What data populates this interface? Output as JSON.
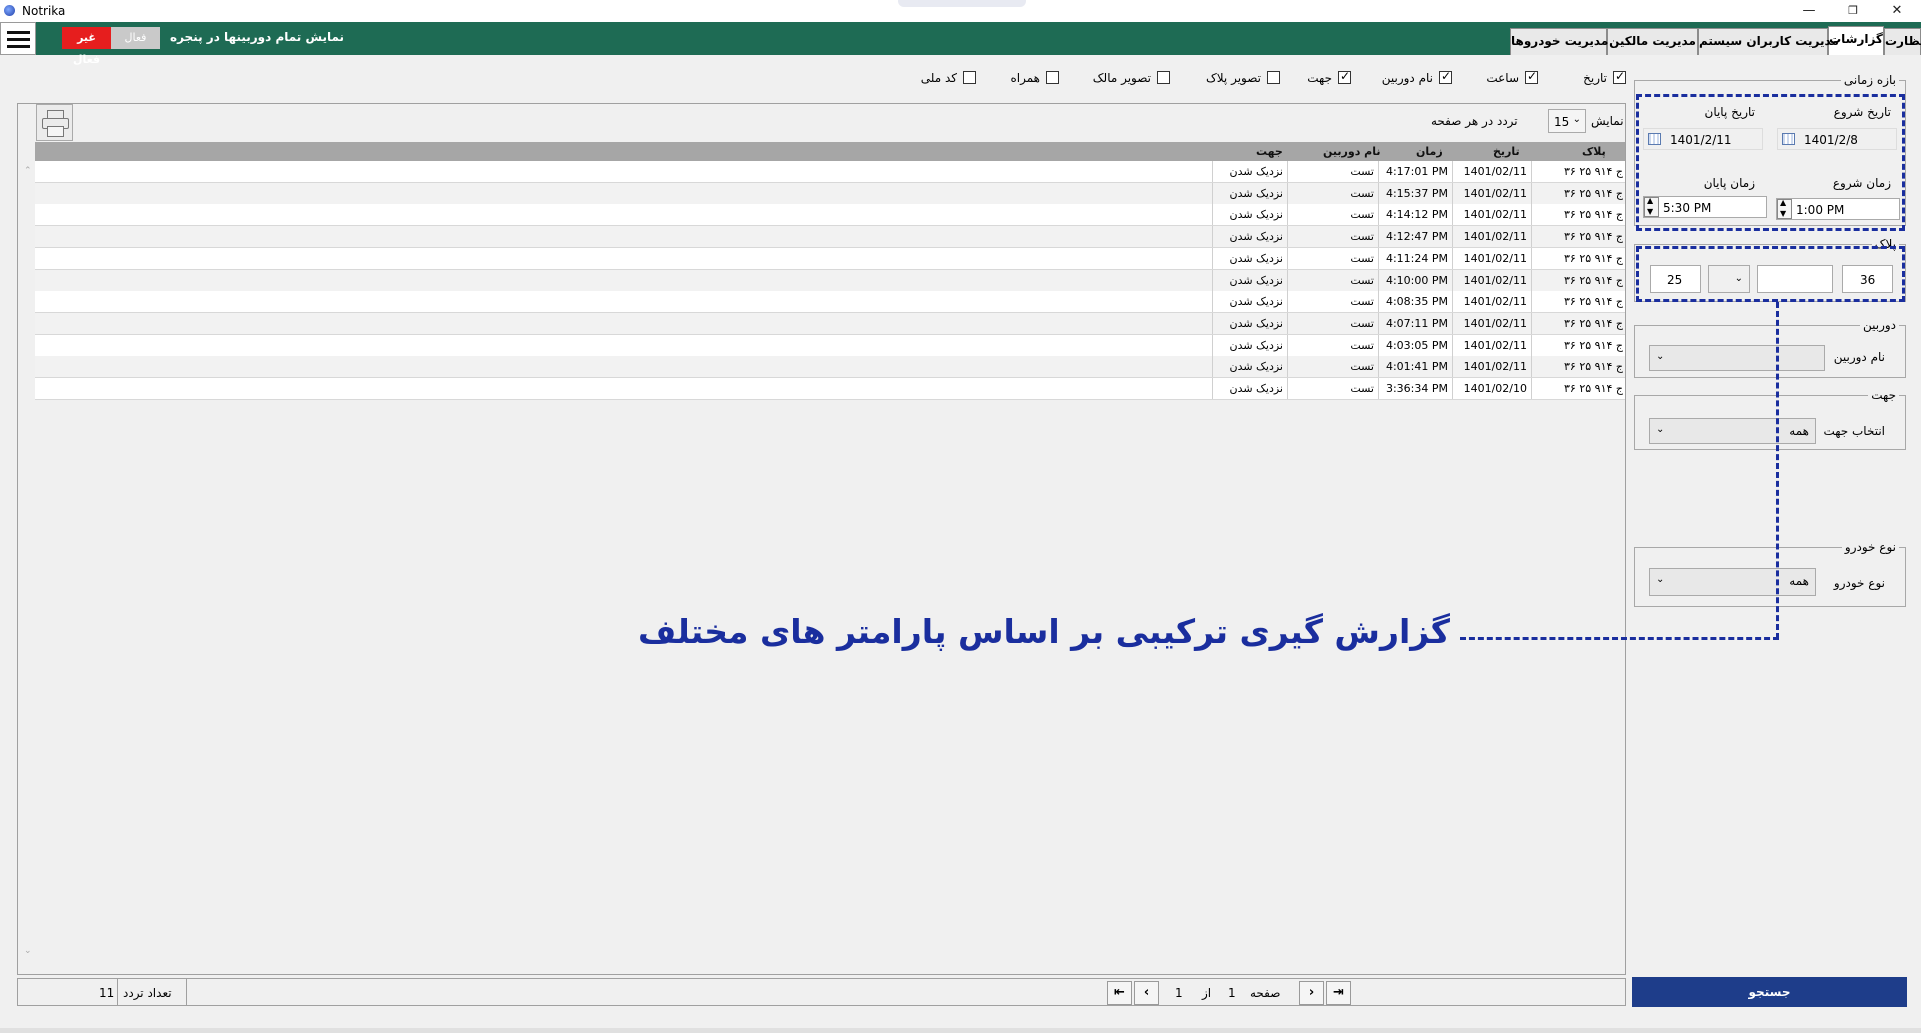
{
  "window": {
    "title": "Notrika",
    "minimize": "—",
    "restore": "❐",
    "close": "✕"
  },
  "header": {
    "status_off": "غیر فعال",
    "status_on": "فعال",
    "label": "نمایش تمام دوربینها در پنجره",
    "tabs": [
      {
        "label": "نظارت"
      },
      {
        "label": "گزارشات"
      },
      {
        "label": "مدیریت کاربران سیستم"
      },
      {
        "label": "مدیریت مالکین"
      },
      {
        "label": "مدیریت خودروها"
      }
    ]
  },
  "column_toggles": [
    {
      "label": "تاریخ",
      "checked": true
    },
    {
      "label": "ساعت",
      "checked": true
    },
    {
      "label": "نام دوربین",
      "checked": true
    },
    {
      "label": "جهت",
      "checked": true
    },
    {
      "label": "تصویر پلاک",
      "checked": false
    },
    {
      "label": "تصویر مالک",
      "checked": false
    },
    {
      "label": "همراه",
      "checked": false
    },
    {
      "label": "کد ملی",
      "checked": false
    }
  ],
  "grid": {
    "show_label": "نمایش",
    "page_size": "15",
    "per_page_label": "تردد در هر صفحه",
    "columns": [
      "پلاک",
      "تاریخ",
      "زمان",
      "نام دوربین",
      "جهت"
    ],
    "rows": [
      [
        "۳۶ ج ۹۱۴ ۲۵",
        "1401/02/11",
        "4:17:01 PM",
        "تست",
        "نزدیک شدن"
      ],
      [
        "۳۶ ج ۹۱۴ ۲۵",
        "1401/02/11",
        "4:15:37 PM",
        "تست",
        "نزدیک شدن"
      ],
      [
        "۳۶ ج ۹۱۴ ۲۵",
        "1401/02/11",
        "4:14:12 PM",
        "تست",
        "نزدیک شدن"
      ],
      [
        "۳۶ ج ۹۱۴ ۲۵",
        "1401/02/11",
        "4:12:47 PM",
        "تست",
        "نزدیک شدن"
      ],
      [
        "۳۶ ج ۹۱۴ ۲۵",
        "1401/02/11",
        "4:11:24 PM",
        "تست",
        "نزدیک شدن"
      ],
      [
        "۳۶ ج ۹۱۴ ۲۵",
        "1401/02/11",
        "4:10:00 PM",
        "تست",
        "نزدیک شدن"
      ],
      [
        "۳۶ ج ۹۱۴ ۲۵",
        "1401/02/11",
        "4:08:35 PM",
        "تست",
        "نزدیک شدن"
      ],
      [
        "۳۶ ج ۹۱۴ ۲۵",
        "1401/02/11",
        "4:07:11 PM",
        "تست",
        "نزدیک شدن"
      ],
      [
        "۳۶ ج ۹۱۴ ۲۵",
        "1401/02/11",
        "4:03:05 PM",
        "تست",
        "نزدیک شدن"
      ],
      [
        "۳۶ ج ۹۱۴ ۲۵",
        "1401/02/11",
        "4:01:41 PM",
        "تست",
        "نزدیک شدن"
      ],
      [
        "۳۶ ج ۹۱۴ ۲۵",
        "1401/02/10",
        "3:36:34 PM",
        "تست",
        "نزدیک شدن"
      ]
    ]
  },
  "footer": {
    "count_label": "تعداد تردد",
    "count": "11",
    "page_label": "صفحه",
    "page": "1",
    "of_label": "از",
    "total_pages": "1"
  },
  "filters": {
    "time_range": {
      "title": "بازه زمانی",
      "start_date_label": "تاریخ شروع",
      "end_date_label": "تاریخ پایان",
      "start_date": "1401/2/8",
      "end_date": "1401/2/11",
      "start_time_label": "زمان شروع",
      "end_time_label": "زمان پایان",
      "start_time": "1:00 PM",
      "end_time": "5:30 PM"
    },
    "plate": {
      "title": "پلاک",
      "part1": "36",
      "part2": "",
      "letter": "",
      "part3": "25"
    },
    "camera": {
      "title": "دوربین",
      "label": "نام دوربین",
      "value": ""
    },
    "direction": {
      "title": "جهت",
      "label": "انتخاب جهت",
      "value": "همه"
    },
    "vehicle_type": {
      "title": "نوع خودرو",
      "label": "نوع خودرو",
      "value": "همه"
    },
    "search_button": "جستجو"
  },
  "annotation": {
    "text": "گزارش گیری ترکیبی بر اساس پارامتر های مختلف"
  },
  "colors": {
    "header_green": "#1e6b54",
    "status_red": "#e61e1e",
    "search_blue": "#1e3d8a",
    "annotation_blue": "#1a2e9e"
  }
}
